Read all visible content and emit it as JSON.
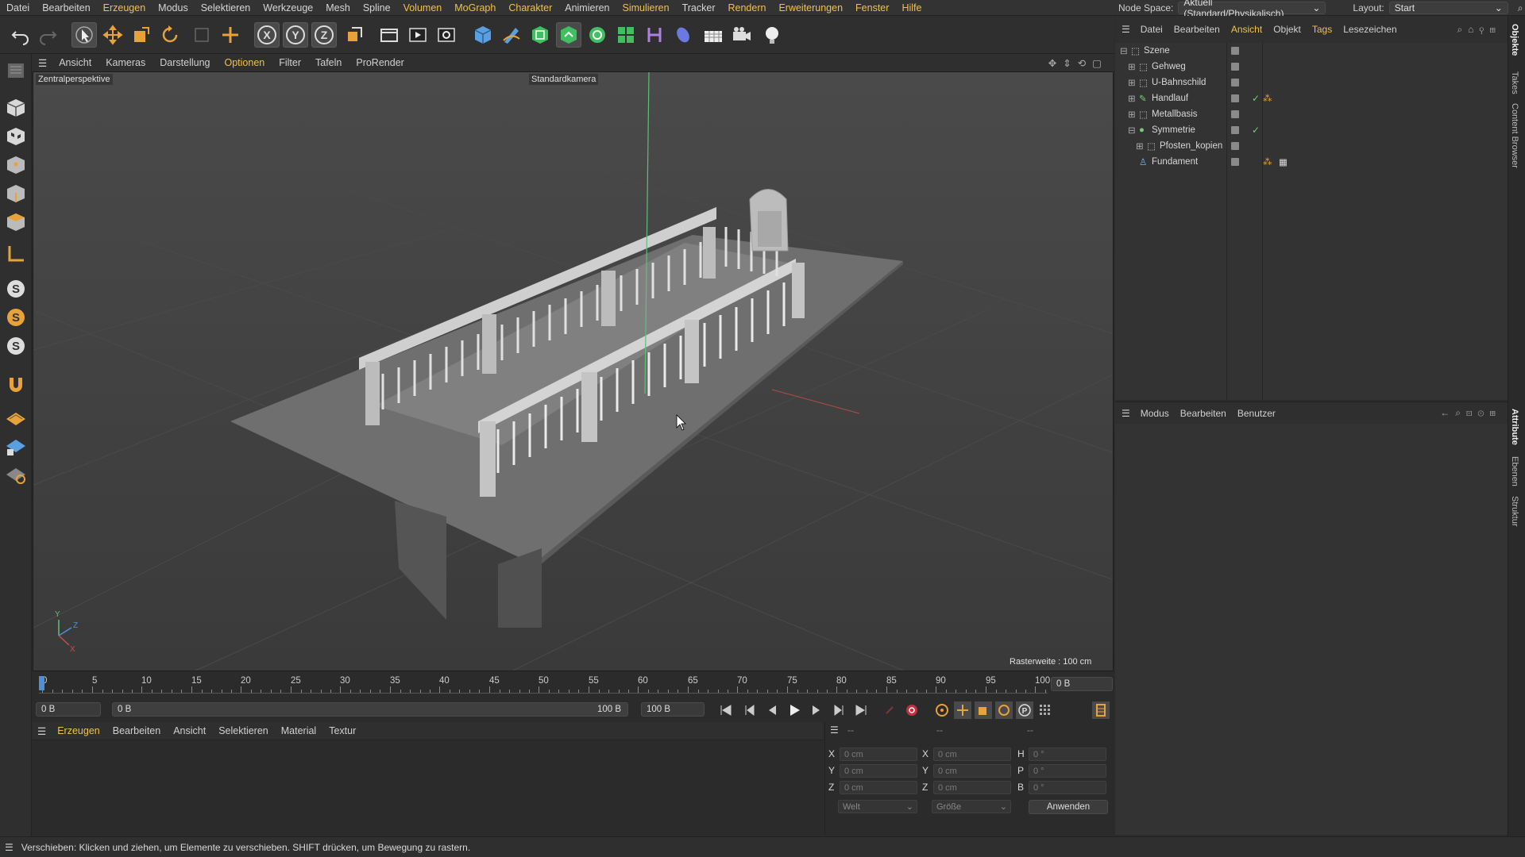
{
  "menu": {
    "items": [
      "Datei",
      "Bearbeiten",
      "Erzeugen",
      "Modus",
      "Selektieren",
      "Werkzeuge",
      "Mesh",
      "Spline",
      "Volumen",
      "MoGraph",
      "Charakter",
      "Animieren",
      "Simulieren",
      "Tracker",
      "Rendern",
      "Erweiterungen",
      "Fenster",
      "Hilfe"
    ],
    "node_space_label": "Node Space:",
    "node_space_value": "Aktuell (Standard/Physikalisch)",
    "layout_label": "Layout:",
    "layout_value": "Start"
  },
  "toolbar": {
    "icons": [
      "undo-icon",
      "redo-icon",
      "select-icon",
      "move-icon",
      "scale-icon",
      "rotate-icon",
      "recent-tool-icon",
      "coordinate-icon",
      "x-axis-icon",
      "y-axis-icon",
      "z-axis-icon",
      "world-coord-icon",
      "render-region-icon",
      "render-view-icon",
      "render-settings-icon",
      "cube-icon",
      "pen-icon",
      "subdivision-icon",
      "extrude-icon",
      "cloner-icon",
      "array-icon",
      "deformer-icon",
      "sweep-icon",
      "floor-icon",
      "camera-icon",
      "light-icon"
    ]
  },
  "viewport": {
    "menu": [
      "Ansicht",
      "Kameras",
      "Darstellung",
      "Optionen",
      "Filter",
      "Tafeln",
      "ProRender"
    ],
    "active_menu": "Optionen",
    "projection_label": "Zentralperspektive",
    "camera_label": "Standardkamera",
    "grid_label": "Rasterweite : 100 cm",
    "axis_labels": [
      "Y",
      "Z",
      "X"
    ]
  },
  "timeline": {
    "ticks": [
      "0",
      "5",
      "10",
      "15",
      "20",
      "25",
      "30",
      "35",
      "40",
      "45",
      "50",
      "55",
      "60",
      "65",
      "70",
      "75",
      "80",
      "85",
      "90",
      "95",
      "100"
    ],
    "current_frame": "0 B",
    "start_field": "0 B",
    "range_start": "0 B",
    "range_end": "100 B",
    "end_field": "100 B"
  },
  "material_manager": {
    "menu": [
      "Erzeugen",
      "Bearbeiten",
      "Ansicht",
      "Selektieren",
      "Material",
      "Textur"
    ],
    "active_menu": "Erzeugen"
  },
  "coordinates": {
    "header_dashes": [
      "--",
      "--",
      "--"
    ],
    "rows": [
      {
        "pos_label": "X",
        "pos_value": "0 cm",
        "size_label": "X",
        "size_value": "0 cm",
        "rot_label": "H",
        "rot_value": "0 °"
      },
      {
        "pos_label": "Y",
        "pos_value": "0 cm",
        "size_label": "Y",
        "size_value": "0 cm",
        "rot_label": "P",
        "rot_value": "0 °"
      },
      {
        "pos_label": "Z",
        "pos_value": "0 cm",
        "size_label": "Z",
        "size_value": "0 cm",
        "rot_label": "B",
        "rot_value": "0 °"
      }
    ],
    "mode_select": "Welt",
    "size_select": "Größe",
    "apply_button": "Anwenden"
  },
  "object_manager": {
    "menu": [
      "Datei",
      "Bearbeiten",
      "Ansicht",
      "Objekt",
      "Tags",
      "Lesezeichen"
    ],
    "active_menu": "Ansicht",
    "objects": [
      {
        "name": "Szene",
        "type": "null"
      },
      {
        "name": "Gehweg",
        "type": "null"
      },
      {
        "name": "U-Bahnschild",
        "type": "null"
      },
      {
        "name": "Handlauf",
        "type": "spline",
        "checked": true
      },
      {
        "name": "Metallbasis",
        "type": "null"
      },
      {
        "name": "Symmetrie",
        "type": "symmetry",
        "checked": true
      },
      {
        "name": "Pfosten_kopien",
        "type": "null"
      },
      {
        "name": "Fundament",
        "type": "figure"
      }
    ]
  },
  "attributes": {
    "menu": [
      "Modus",
      "Bearbeiten",
      "Benutzer"
    ]
  },
  "right_tabs": [
    "Objekte",
    "Takes",
    "Content Browser",
    "Attribute",
    "Ebenen",
    "Struktur"
  ],
  "status": {
    "text": "Verschieben: Klicken und ziehen, um Elemente zu verschieben. SHIFT drücken, um Bewegung zu rastern."
  },
  "colors": {
    "accent": "#f0c24a",
    "panel": "#2f2f2f",
    "viewport": "#3f3f3f",
    "active_blue": "#4d8fd8"
  }
}
